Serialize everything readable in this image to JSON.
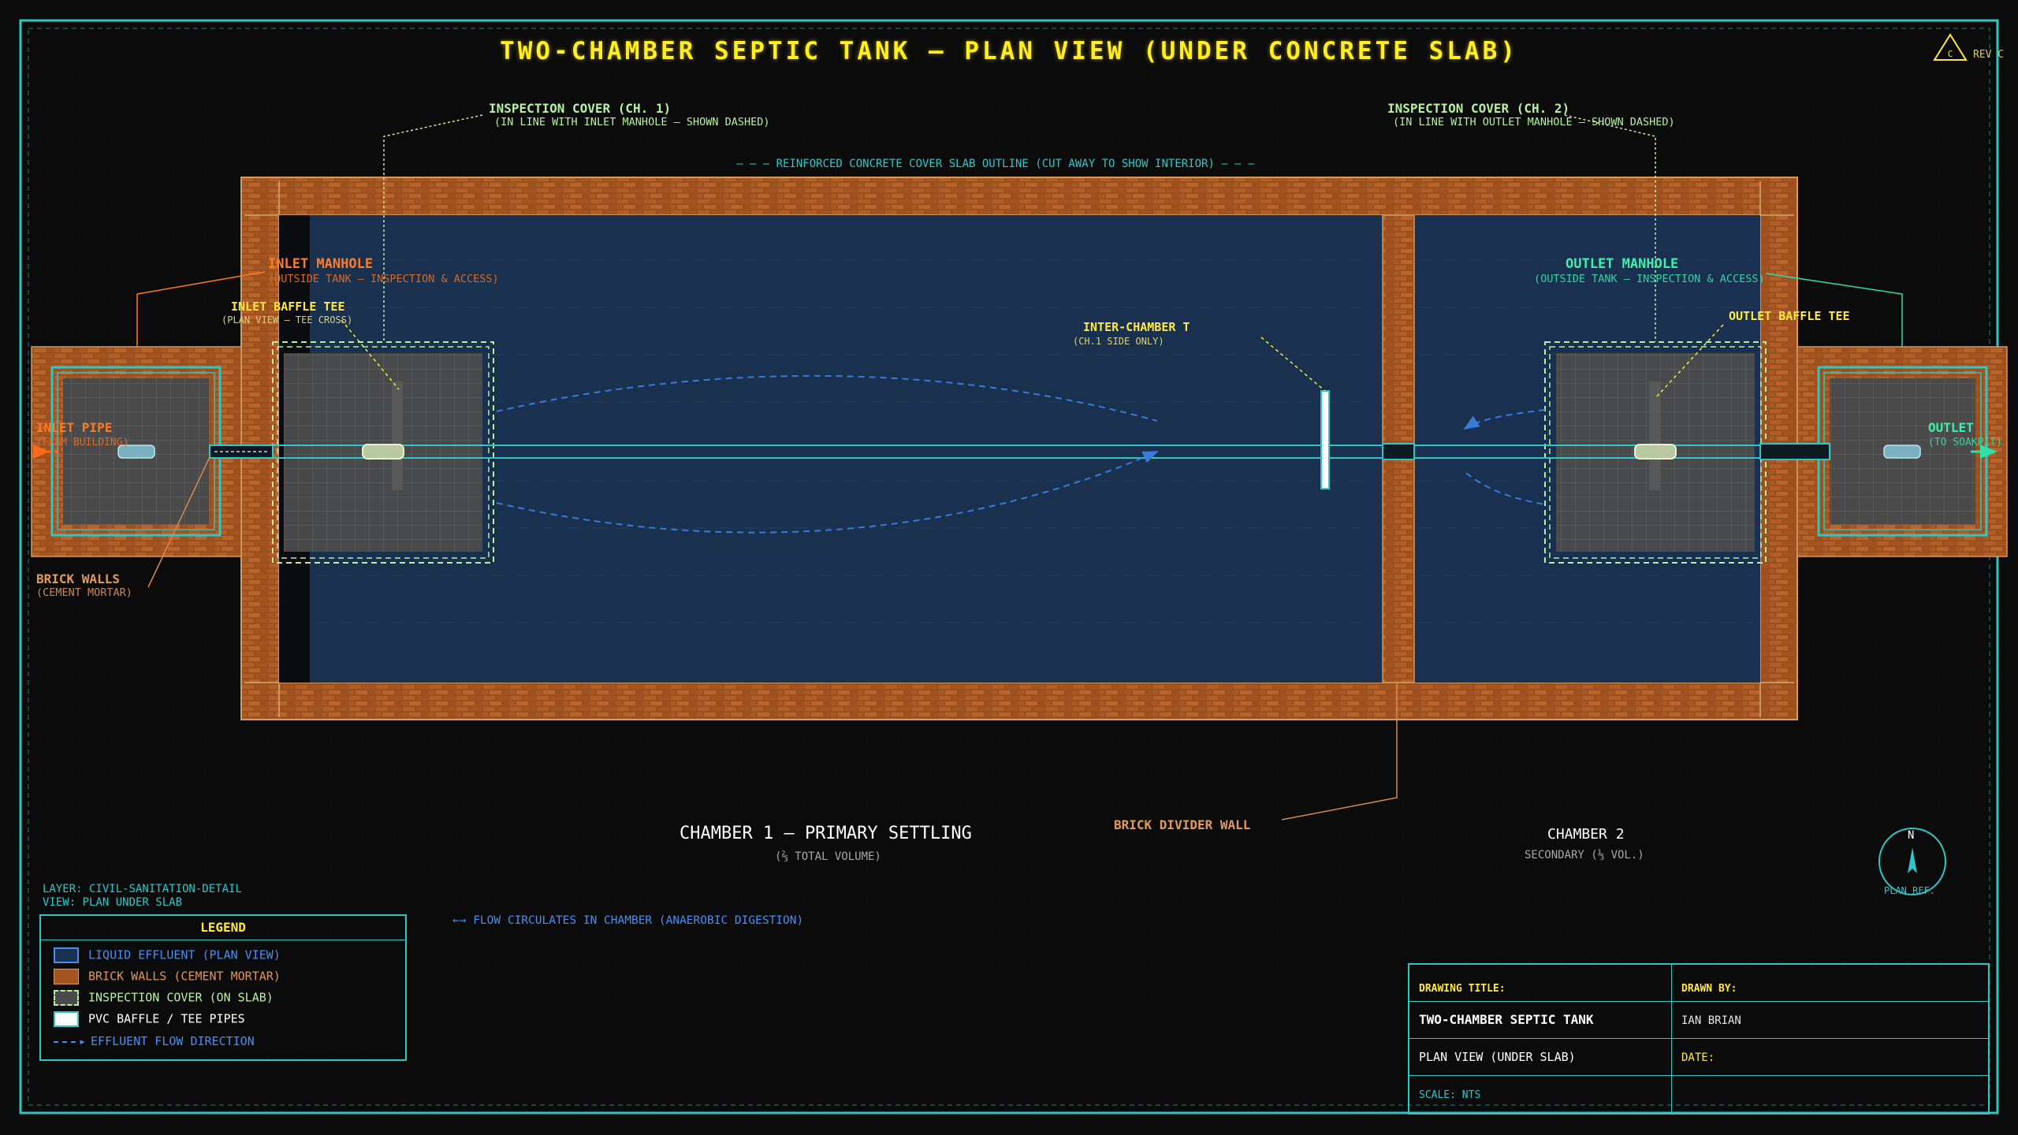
{
  "title": "TWO-CHAMBER SEPTIC TANK — PLAN VIEW (UNDER CONCRETE SLAB)",
  "revision": "REV C",
  "revision_mark": "C",
  "slab_outline_note": "— — — REINFORCED CONCRETE COVER SLAB OUTLINE (CUT AWAY TO SHOW INTERIOR) — — —",
  "labels": {
    "inspection_cover_1": {
      "title": "INSPECTION COVER (CH. 1)",
      "sub": "(IN LINE WITH INLET MANHOLE — SHOWN DASHED)"
    },
    "inspection_cover_2": {
      "title": "INSPECTION COVER (CH. 2)",
      "sub": "(IN LINE WITH OUTLET MANHOLE — SHOWN DASHED)"
    },
    "inlet_manhole": {
      "title": "INLET MANHOLE",
      "sub": "(OUTSIDE TANK — INSPECTION & ACCESS)"
    },
    "outlet_manhole": {
      "title": "OUTLET MANHOLE",
      "sub": "(OUTSIDE TANK — INSPECTION & ACCESS)"
    },
    "inlet_baffle_tee": {
      "title": "INLET BAFFLE TEE",
      "sub": "(PLAN VIEW — TEE CROSS)"
    },
    "outlet_baffle_tee": {
      "title": "OUTLET BAFFLE TEE"
    },
    "inter_chamber_t": {
      "title": "INTER-CHAMBER T",
      "sub": "(CH.1 SIDE ONLY)"
    },
    "inlet_pipe": {
      "title": "INLET PIPE",
      "sub": "(FROM BUILDING)"
    },
    "outlet": {
      "title": "OUTLET",
      "sub": "(TO SOAKPIT)"
    },
    "brick_walls": {
      "title": "BRICK WALLS",
      "sub": "(CEMENT MORTAR)"
    },
    "brick_divider_wall": {
      "title": "BRICK DIVIDER WALL"
    }
  },
  "chambers": {
    "chamber1": {
      "title": "CHAMBER 1 — PRIMARY SETTLING",
      "sub": "(⅔ TOTAL VOLUME)"
    },
    "chamber2": {
      "title": "CHAMBER 2",
      "sub": "SECONDARY (⅓ VOL.)"
    }
  },
  "layer_info": {
    "layer": "LAYER: CIVIL-SANITATION-DETAIL",
    "view": "VIEW: PLAN UNDER SLAB"
  },
  "flow_note": "←→ FLOW CIRCULATES IN CHAMBER (ANAEROBIC DIGESTION)",
  "legend": {
    "title": "LEGEND",
    "items": [
      {
        "label": "LIQUID EFFLUENT (PLAN VIEW)",
        "color": "#4a8ef0"
      },
      {
        "label": "BRICK WALLS (CEMENT MORTAR)",
        "color": "#e0955a"
      },
      {
        "label": "INSPECTION COVER (ON SLAB)",
        "color": "#b6f0a0"
      },
      {
        "label": "PVC BAFFLE / TEE PIPES",
        "color": "#ffffff"
      },
      {
        "label": "EFFLUENT FLOW DIRECTION",
        "color": "#4a8ef0"
      }
    ]
  },
  "compass": {
    "north": "N",
    "label": "PLAN REF."
  },
  "title_block": {
    "drawing_title_label": "DRAWING TITLE:",
    "drawn_by_label": "DRAWN BY:",
    "drawing_title": "TWO-CHAMBER SEPTIC TANK",
    "drawn_by": "IAN BRIAN",
    "view": "PLAN VIEW (UNDER SLAB)",
    "date_label": "DATE:",
    "scale": "SCALE: NTS"
  },
  "colors": {
    "background": "#0b0b0b",
    "frame": "#2fc6c6",
    "brick": "#9a4a1c",
    "liquid": "#1a3050",
    "cover": "#b6f0a0",
    "title": "#ffee22"
  }
}
